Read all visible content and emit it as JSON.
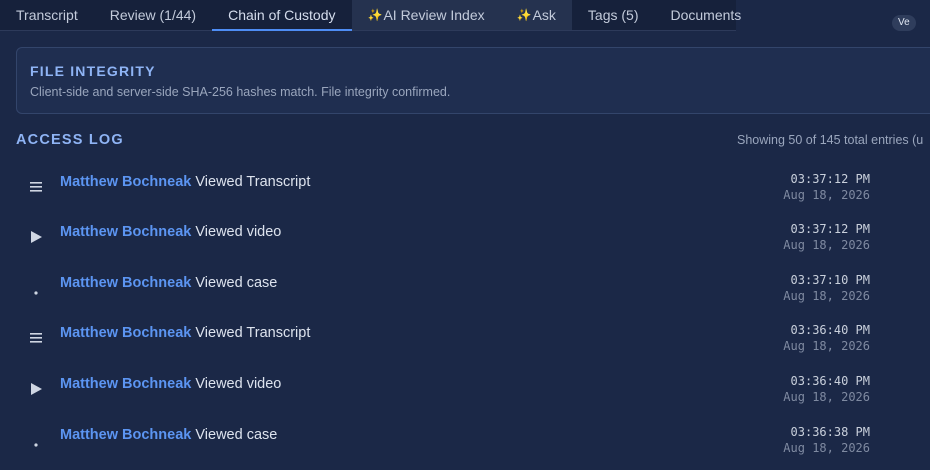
{
  "tabs": [
    {
      "label": "Transcript"
    },
    {
      "label": "Review (1/44)"
    },
    {
      "label": "Chain of Custody"
    },
    {
      "label": "AI Review Index",
      "spark": "✨"
    },
    {
      "label": "Ask",
      "spark": "✨"
    },
    {
      "label": "Tags (5)"
    },
    {
      "label": "Documents"
    }
  ],
  "integrity": {
    "title": "FILE INTEGRITY",
    "description": "Client-side and server-side SHA-256 hashes match. File integrity confirmed.",
    "badge": "Ve"
  },
  "access_log": {
    "title": "ACCESS LOG",
    "count_text": "Showing 50 of 145 total entries (u",
    "entries": [
      {
        "icon": "list-icon",
        "user": "Matthew Bochneak",
        "action": "Viewed Transcript",
        "time": "03:37:12 PM",
        "date": "Aug 18, 2026"
      },
      {
        "icon": "play-icon",
        "user": "Matthew Bochneak",
        "action": "Viewed video",
        "time": "03:37:12 PM",
        "date": "Aug 18, 2026"
      },
      {
        "icon": "dot-icon",
        "user": "Matthew Bochneak",
        "action": "Viewed case",
        "time": "03:37:10 PM",
        "date": "Aug 18, 2026"
      },
      {
        "icon": "list-icon",
        "user": "Matthew Bochneak",
        "action": "Viewed Transcript",
        "time": "03:36:40 PM",
        "date": "Aug 18, 2026"
      },
      {
        "icon": "play-icon",
        "user": "Matthew Bochneak",
        "action": "Viewed video",
        "time": "03:36:40 PM",
        "date": "Aug 18, 2026"
      },
      {
        "icon": "dot-icon",
        "user": "Matthew Bochneak",
        "action": "Viewed case",
        "time": "03:36:38 PM",
        "date": "Aug 18, 2026"
      }
    ]
  }
}
